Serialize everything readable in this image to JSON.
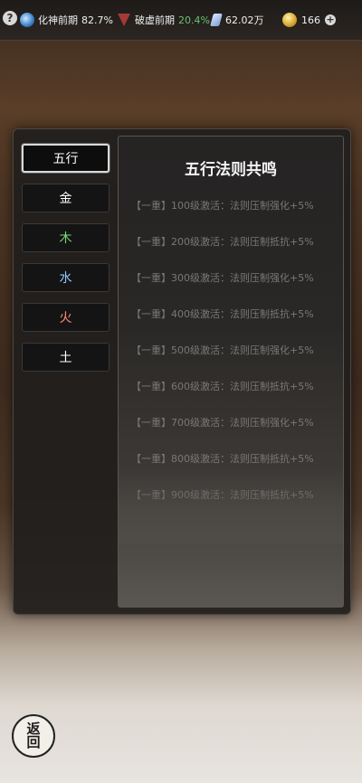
{
  "topbar": {
    "help_label": "?",
    "realm_name": "化神前期",
    "realm_progress": "82.7%",
    "tribulation_name": "破虚前期",
    "tribulation_progress": "20.4%",
    "spirit_stones": "62.02万",
    "gold": "166",
    "plus_label": "+"
  },
  "tabs": [
    {
      "label": "五行",
      "color": "#ffffff",
      "active": true
    },
    {
      "label": "金",
      "color": "#ffffff",
      "active": false
    },
    {
      "label": "木",
      "color": "#78d877",
      "active": false
    },
    {
      "label": "水",
      "color": "#8ec6ff",
      "active": false
    },
    {
      "label": "火",
      "color": "#ff8c7a",
      "active": false
    },
    {
      "label": "土",
      "color": "#ffffff",
      "active": false
    }
  ],
  "content": {
    "title": "五行法则共鸣",
    "effects": [
      "【一重】100级激活：法则压制强化+5%",
      "【一重】200级激活：法则压制抵抗+5%",
      "【一重】300级激活：法则压制强化+5%",
      "【一重】400级激活：法则压制抵抗+5%",
      "【一重】500级激活：法则压制强化+5%",
      "【一重】600级激活：法则压制抵抗+5%",
      "【一重】700级激活：法则压制强化+5%",
      "【一重】800级激活：法则压制抵抗+5%",
      "【一重】900级激活：法则压制抵抗+5%"
    ]
  },
  "back_button": {
    "line1": "返",
    "line2": "回"
  }
}
